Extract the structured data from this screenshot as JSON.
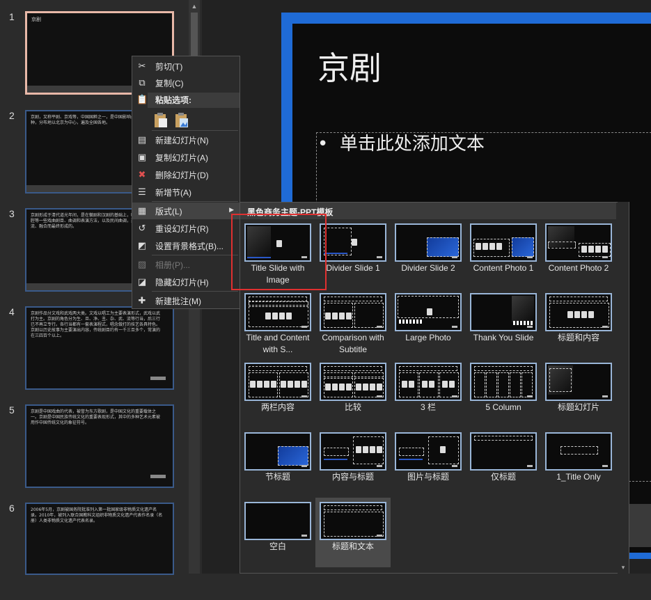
{
  "thumbnails": [
    {
      "num": "1",
      "text": "京剧",
      "selected": true
    },
    {
      "num": "2",
      "text": "京剧，又称平剧、京戏等，中国国粹之一，是中国影响最大的戏曲剧种，分布地以北京为中心，遍及全国各地。",
      "selected": false
    },
    {
      "num": "3",
      "text": "京剧形成于清代道光年间，是在徽剧和汉剧的基础上，吸收了昆曲、秦腔等一些戏曲剧目、曲调和表演方法，以及民间曲调，通过不断的交流、融合而最终形成的。",
      "selected": false
    },
    {
      "num": "4",
      "text": "京剧作品分文戏和武戏两大类。文戏以唱工为主要表演形式，武戏以武打为主。京剧的角色分为生、旦、净、丑、杂、武、流等行当，后三行已不再立专行。各行当都有一套表演程式，唱念做打的技艺各具特色。京剧以历史故事为主要演出内容，传统剧目约有一千三百多个，常演的在三四百个以上。",
      "selected": false
    },
    {
      "num": "5",
      "text": "京剧是中国戏曲的代表，被誉为东方歌剧，是中国文化的重要载体之一。京剧是中国民族传统文化的重要表现形式，其中的多种艺术元素被用作中国传统文化的象征符号。",
      "selected": false
    },
    {
      "num": "6",
      "text": "2006年5月，京剧被国务院批准列入第一批国家级非物质文化遗产名录。2010年，被列入联合国教科文组织非物质文化遗产代表作名录（名册）人类非物质文化遗产代表名录。",
      "selected": false
    }
  ],
  "slide": {
    "title": "京剧",
    "body_placeholder": "单击此处添加文本"
  },
  "context_menu": {
    "cut": "剪切(T)",
    "copy": "复制(C)",
    "paste_options": "粘贴选项:",
    "new_slide": "新建幻灯片(N)",
    "duplicate_slide": "复制幻灯片(A)",
    "delete_slide": "删除幻灯片(D)",
    "add_section": "新增节(A)",
    "layout": "版式(L)",
    "reset_slide": "重设幻灯片(R)",
    "format_background": "设置背景格式(B)...",
    "photo_album": "相册(P)...",
    "hide_slide": "隐藏幻灯片(H)",
    "new_comment": "新建批注(M)"
  },
  "layout_gallery": {
    "header": "黑色商务主题-PPT模板",
    "layouts": [
      "Title Slide with Image",
      "Divider Slide 1",
      "Divider Slide 2",
      "Content Photo 1",
      "Content Photo 2",
      "Title and Content with S...",
      "Comparison with Subtitle",
      "Large Photo",
      "Thank You Slide",
      "标题和内容",
      "两栏内容",
      "比较",
      "3 栏",
      "5 Column",
      "标题幻灯片",
      "节标题",
      "内容与标题",
      "图片与标题",
      "仅标题",
      "1_Title Only",
      "空白",
      "标题和文本"
    ],
    "selected": "标题和文本"
  },
  "colors": {
    "accent": "#1f6bd6",
    "highlight_box": "#e03030",
    "selected_thumb_border": "#e8b8a8"
  }
}
